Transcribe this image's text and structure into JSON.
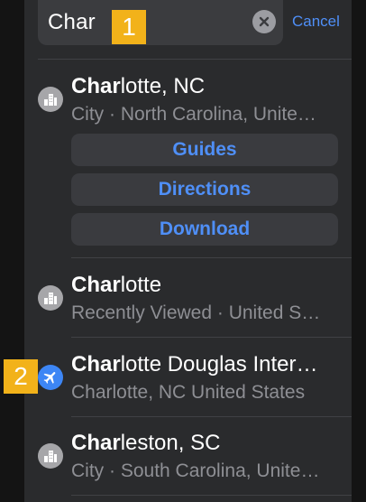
{
  "search": {
    "query": "Char",
    "cancel_label": "Cancel"
  },
  "badges": {
    "one": "1",
    "two": "2"
  },
  "results": [
    {
      "match": "Char",
      "rest": "lotte, NC",
      "subtitle": "City · North Carolina, Unite…",
      "icon": "city-icon",
      "actions": [
        "Guides",
        "Directions",
        "Download"
      ]
    },
    {
      "match": "Char",
      "rest": "lotte",
      "subtitle": "Recently Viewed · United S…",
      "icon": "city-icon"
    },
    {
      "match": "Char",
      "rest": "lotte Douglas Inter…",
      "subtitle": "Charlotte, NC United States",
      "icon": "airplane-icon"
    },
    {
      "match": "Char",
      "rest": "leston, SC",
      "subtitle": "City · South Carolina, Unite…",
      "icon": "city-icon"
    }
  ],
  "colors": {
    "accent": "#4f8ff7",
    "badge": "#f2b21a",
    "panel": "#2a2b2d"
  }
}
